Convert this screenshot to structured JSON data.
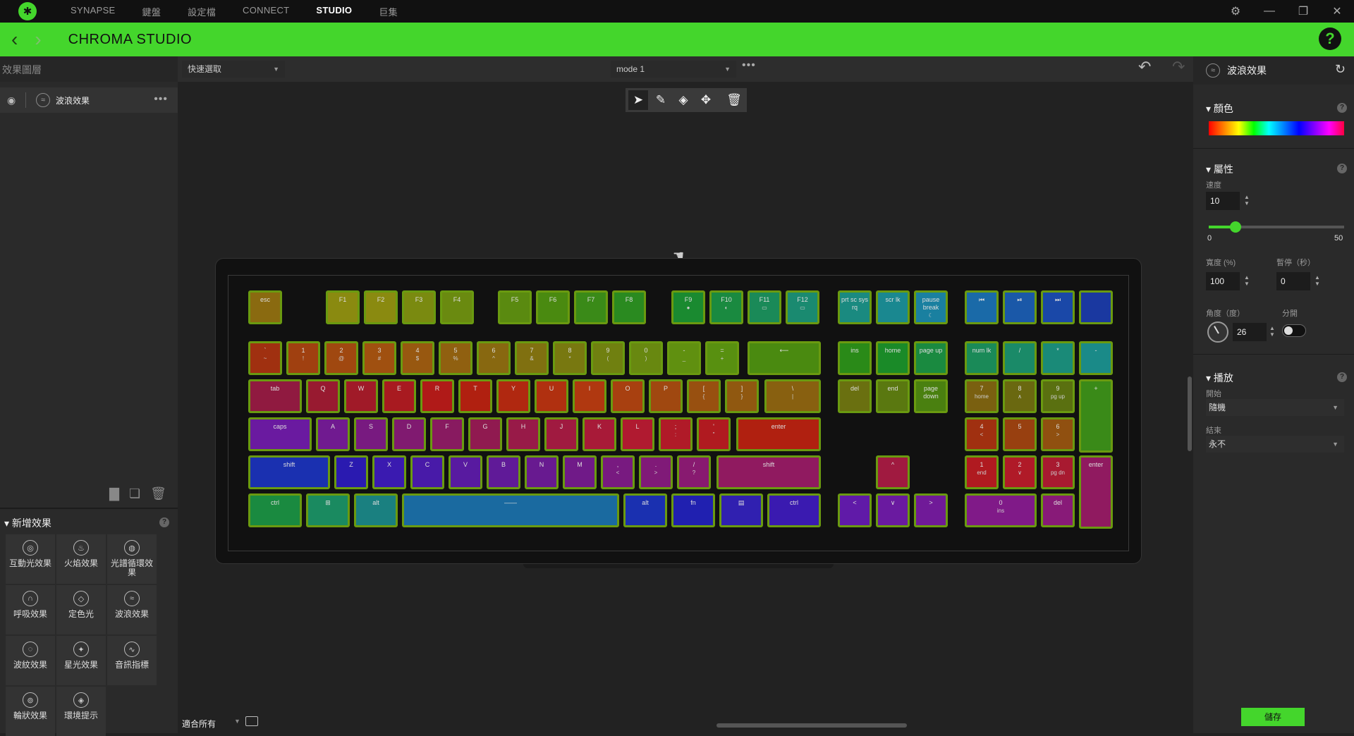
{
  "titlebar": {
    "logo": "razer-logo",
    "tabs": [
      "SYNAPSE",
      "鍵盤",
      "設定檔",
      "CONNECT",
      "STUDIO",
      "巨集"
    ],
    "active_tab": "STUDIO"
  },
  "header": {
    "title": "CHROMA STUDIO",
    "help": "?"
  },
  "left_panel": {
    "title": "效果圖層",
    "layer": {
      "name": "波浪效果",
      "menu": "•••"
    },
    "add_title": "新增效果",
    "effects": [
      "互動光效果",
      "火焰效果",
      "光譜循環效果",
      "呼吸效果",
      "定色光",
      "波浪效果",
      "波紋效果",
      "星光效果",
      "音訊指標",
      "輪狀效果",
      "環境提示"
    ]
  },
  "canvas": {
    "quick_select": "快速選取",
    "mode": "mode 1",
    "more": "•••",
    "fit_label": "適合所有"
  },
  "right_panel": {
    "effect_title": "波浪效果",
    "color_section": "顏色",
    "props_section": "屬性",
    "speed_label": "速度",
    "speed_value": "10",
    "speed_min": "0",
    "speed_max": "50",
    "speed_fraction": 0.2,
    "width_label": "寬度 (%)",
    "width_value": "100",
    "pause_label": "暫停（秒）",
    "pause_value": "0",
    "angle_label": "角度（度）",
    "angle_value": "26",
    "split_label": "分開",
    "play_section": "播放",
    "start_label": "開始",
    "start_value": "隨機",
    "end_label": "結束",
    "end_value": "永不",
    "save": "儲存"
  },
  "colors": {
    "accent": "#44d62c",
    "key_border": "#6a9a10"
  },
  "keyboard": {
    "keys": [
      {
        "label": "esc",
        "sub": "",
        "color": "#8a6a10"
      },
      {
        "label": "F1",
        "sub": "",
        "color": "#8a8a10"
      },
      {
        "label": "F2",
        "sub": "",
        "color": "#8a8a10"
      },
      {
        "label": "F3",
        "sub": "",
        "color": "#7a8a10"
      },
      {
        "label": "F4",
        "sub": "",
        "color": "#6a8a10"
      },
      {
        "label": "F5",
        "sub": "",
        "color": "#5a8a10"
      },
      {
        "label": "F6",
        "sub": "",
        "color": "#4a8a10"
      },
      {
        "label": "F7",
        "sub": "",
        "color": "#3a8a18"
      },
      {
        "label": "F8",
        "sub": "",
        "color": "#2a8a20"
      },
      {
        "label": "F9",
        "sub": "●",
        "color": "#1a8a30"
      },
      {
        "label": "F10",
        "sub": "◐",
        "color": "#1a8a40"
      },
      {
        "label": "F11",
        "sub": "▭",
        "color": "#1a8a58"
      },
      {
        "label": "F12",
        "sub": "▭",
        "color": "#1a8a70"
      },
      {
        "label": "prt sc sys rq",
        "sub": "",
        "color": "#1a8a80"
      },
      {
        "label": "scr lk",
        "sub": "",
        "color": "#1a8890"
      },
      {
        "label": "pause break",
        "sub": "☾",
        "color": "#1a80a0"
      },
      {
        "label": "⏮",
        "sub": "",
        "color": "#1a6aa8"
      },
      {
        "label": "⏯",
        "sub": "",
        "color": "#1a58a8"
      },
      {
        "label": "⏭",
        "sub": "",
        "color": "#1a48a8"
      },
      {
        "label": "",
        "sub": "",
        "color": "#1a38a0"
      },
      {
        "label": "`",
        "sub": "~",
        "color": "#a03010"
      },
      {
        "label": "1",
        "sub": "!",
        "color": "#a04010"
      },
      {
        "label": "2",
        "sub": "@",
        "color": "#a04810"
      },
      {
        "label": "3",
        "sub": "#",
        "color": "#a05010"
      },
      {
        "label": "4",
        "sub": "$",
        "color": "#985810"
      },
      {
        "label": "5",
        "sub": "%",
        "color": "#906010"
      },
      {
        "label": "6",
        "sub": "^",
        "color": "#886810"
      },
      {
        "label": "7",
        "sub": "&",
        "color": "#807010"
      },
      {
        "label": "8",
        "sub": "*",
        "color": "#787810"
      },
      {
        "label": "9",
        "sub": "(",
        "color": "#708010"
      },
      {
        "label": "0",
        "sub": ")",
        "color": "#688810"
      },
      {
        "label": "-",
        "sub": "_",
        "color": "#609010"
      },
      {
        "label": "=",
        "sub": "+",
        "color": "#589010"
      },
      {
        "label": "⟵",
        "sub": "",
        "color": "#4a8a10"
      },
      {
        "label": "ins",
        "sub": "",
        "color": "#2a8a18"
      },
      {
        "label": "home",
        "sub": "",
        "color": "#1a8a28"
      },
      {
        "label": "page up",
        "sub": "",
        "color": "#1a8a40"
      },
      {
        "label": "num lk",
        "sub": "",
        "color": "#1a8a58"
      },
      {
        "label": "/",
        "sub": "",
        "color": "#1a8a68"
      },
      {
        "label": "*",
        "sub": "",
        "color": "#1a8a78"
      },
      {
        "label": "-",
        "sub": "",
        "color": "#1a8a88"
      },
      {
        "label": "tab",
        "sub": "",
        "color": "#901a40"
      },
      {
        "label": "Q",
        "sub": "",
        "color": "#981a30"
      },
      {
        "label": "W",
        "sub": "",
        "color": "#a01a28"
      },
      {
        "label": "E",
        "sub": "",
        "color": "#a81a20"
      },
      {
        "label": "R",
        "sub": "",
        "color": "#b01a18"
      },
      {
        "label": "T",
        "sub": "",
        "color": "#b02010"
      },
      {
        "label": "Y",
        "sub": "",
        "color": "#b02810"
      },
      {
        "label": "U",
        "sub": "",
        "color": "#b03010"
      },
      {
        "label": "I",
        "sub": "",
        "color": "#b03810"
      },
      {
        "label": "O",
        "sub": "",
        "color": "#a84010"
      },
      {
        "label": "P",
        "sub": "",
        "color": "#a04810"
      },
      {
        "label": "[",
        "sub": "{",
        "color": "#985010"
      },
      {
        "label": "]",
        "sub": "}",
        "color": "#905810"
      },
      {
        "label": "\\",
        "sub": "|",
        "color": "#886010"
      },
      {
        "label": "del",
        "sub": "",
        "color": "#6a7010"
      },
      {
        "label": "end",
        "sub": "",
        "color": "#5a7810"
      },
      {
        "label": "page down",
        "sub": "",
        "color": "#4a8010"
      },
      {
        "label": "7",
        "sub": "home",
        "color": "#7a6010"
      },
      {
        "label": "8",
        "sub": "∧",
        "color": "#6a6810"
      },
      {
        "label": "9",
        "sub": "pg up",
        "color": "#5a7010"
      },
      {
        "label": "+",
        "sub": "",
        "color": "#3a8a18"
      },
      {
        "label": "caps",
        "sub": "",
        "color": "#6a1aa0"
      },
      {
        "label": "A",
        "sub": "",
        "color": "#701a90"
      },
      {
        "label": "S",
        "sub": "",
        "color": "#781a80"
      },
      {
        "label": "D",
        "sub": "",
        "color": "#801a70"
      },
      {
        "label": "F",
        "sub": "",
        "color": "#881a60"
      },
      {
        "label": "G",
        "sub": "",
        "color": "#901a50"
      },
      {
        "label": "H",
        "sub": "",
        "color": "#981a48"
      },
      {
        "label": "J",
        "sub": "",
        "color": "#a01a40"
      },
      {
        "label": "K",
        "sub": "",
        "color": "#a81a38"
      },
      {
        "label": "L",
        "sub": "",
        "color": "#b01a30"
      },
      {
        "label": ";",
        "sub": ":",
        "color": "#b01a28"
      },
      {
        "label": "'",
        "sub": "\"",
        "color": "#b01a20"
      },
      {
        "label": "enter",
        "sub": "",
        "color": "#b02010"
      },
      {
        "label": "4",
        "sub": "<",
        "color": "#a03010"
      },
      {
        "label": "5",
        "sub": "",
        "color": "#984010"
      },
      {
        "label": "6",
        "sub": ">",
        "color": "#905010"
      },
      {
        "label": "shift",
        "sub": "",
        "color": "#1a30b0"
      },
      {
        "label": "Z",
        "sub": "",
        "color": "#2a1ab0"
      },
      {
        "label": "X",
        "sub": "",
        "color": "#3a1ab0"
      },
      {
        "label": "C",
        "sub": "",
        "color": "#481aa8"
      },
      {
        "label": "V",
        "sub": "",
        "color": "#581aa0"
      },
      {
        "label": "B",
        "sub": "",
        "color": "#601a98"
      },
      {
        "label": "N",
        "sub": "",
        "color": "#681a90"
      },
      {
        "label": "M",
        "sub": "",
        "color": "#701a88"
      },
      {
        "label": ",",
        "sub": "<",
        "color": "#781a80"
      },
      {
        "label": ".",
        "sub": ">",
        "color": "#801a78"
      },
      {
        "label": "/",
        "sub": "?",
        "color": "#881a70"
      },
      {
        "label": "shift",
        "sub": "",
        "color": "#901a60"
      },
      {
        "label": "^",
        "sub": "",
        "color": "#a01a40"
      },
      {
        "label": "1",
        "sub": "end",
        "color": "#b01a20"
      },
      {
        "label": "2",
        "sub": "∨",
        "color": "#b01a28"
      },
      {
        "label": "3",
        "sub": "pg dn",
        "color": "#a81a30"
      },
      {
        "label": "enter",
        "sub": "",
        "color": "#901a60"
      },
      {
        "label": "ctrl",
        "sub": "",
        "color": "#1a8a40"
      },
      {
        "label": "⊞",
        "sub": "",
        "color": "#1a8a60"
      },
      {
        "label": "alt",
        "sub": "",
        "color": "#1a8080"
      },
      {
        "label": "——",
        "sub": "",
        "color": "#1a6aa0"
      },
      {
        "label": "alt",
        "sub": "",
        "color": "#1a30b0"
      },
      {
        "label": "fn",
        "sub": "",
        "color": "#2020b0"
      },
      {
        "label": "▤",
        "sub": "",
        "color": "#3020b0"
      },
      {
        "label": "ctrl",
        "sub": "",
        "color": "#3a1ab0"
      },
      {
        "label": "<",
        "sub": "",
        "color": "#601aa8"
      },
      {
        "label": "∨",
        "sub": "",
        "color": "#6a1aa0"
      },
      {
        "label": ">",
        "sub": "",
        "color": "#701a98"
      },
      {
        "label": "0",
        "sub": "ins",
        "color": "#801a88"
      },
      {
        "label": "del",
        "sub": "",
        "color": "#881a78"
      }
    ]
  }
}
